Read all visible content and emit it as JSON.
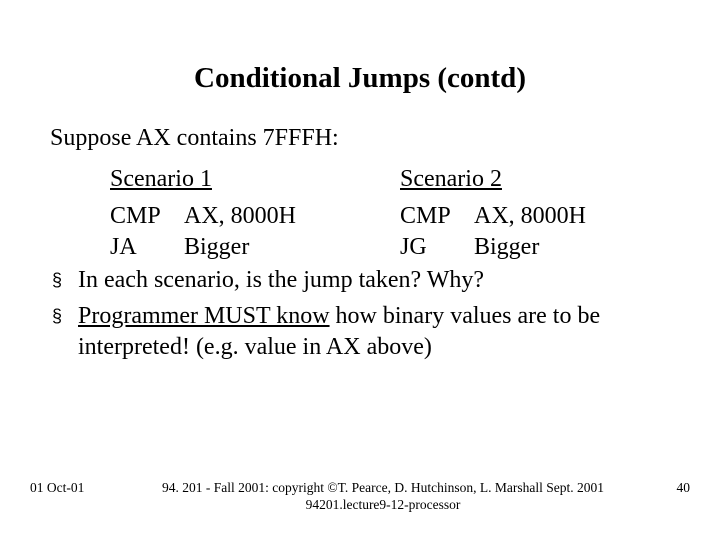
{
  "title": "Conditional Jumps (contd)",
  "suppose": "Suppose AX contains  7FFFH:",
  "scenario1": {
    "heading": "Scenario 1",
    "line1_mnem": "CMP",
    "line1_op": "AX, 8000H",
    "line2_mnem": "JA",
    "line2_op": "Bigger"
  },
  "scenario2": {
    "heading": "Scenario 2",
    "line1_mnem": "CMP",
    "line1_op": "AX, 8000H",
    "line2_mnem": "JG",
    "line2_op": "Bigger"
  },
  "bullets": {
    "b1": "In each scenario, is the jump taken?   Why?",
    "b2_u": "Programmer MUST know",
    "b2_rest": " how binary values are to be interpreted!   (e.g. value in AX above)"
  },
  "footer": {
    "date": "01 Oct-01",
    "line1": "94. 201 - Fall 2001: copyright ©T. Pearce, D. Hutchinson, L. Marshall Sept. 2001",
    "line2": "94201.lecture9-12-processor",
    "page": "40"
  }
}
